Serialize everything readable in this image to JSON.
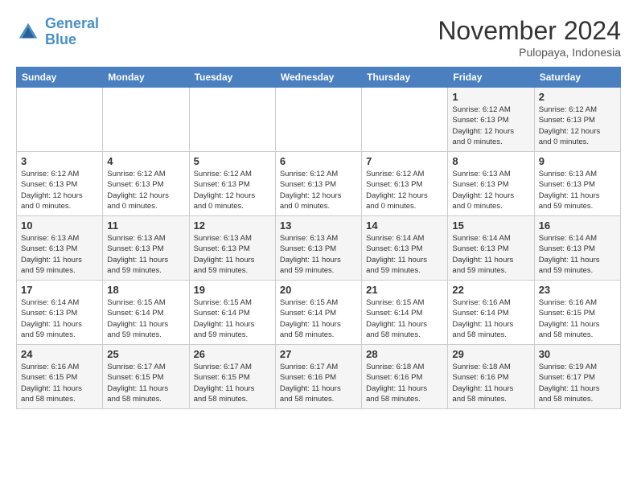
{
  "logo": {
    "line1": "General",
    "line2": "Blue"
  },
  "title": "November 2024",
  "subtitle": "Pulopaya, Indonesia",
  "days_of_week": [
    "Sunday",
    "Monday",
    "Tuesday",
    "Wednesday",
    "Thursday",
    "Friday",
    "Saturday"
  ],
  "weeks": [
    [
      {
        "day": "",
        "info": ""
      },
      {
        "day": "",
        "info": ""
      },
      {
        "day": "",
        "info": ""
      },
      {
        "day": "",
        "info": ""
      },
      {
        "day": "",
        "info": ""
      },
      {
        "day": "1",
        "info": "Sunrise: 6:12 AM\nSunset: 6:13 PM\nDaylight: 12 hours\nand 0 minutes."
      },
      {
        "day": "2",
        "info": "Sunrise: 6:12 AM\nSunset: 6:13 PM\nDaylight: 12 hours\nand 0 minutes."
      }
    ],
    [
      {
        "day": "3",
        "info": "Sunrise: 6:12 AM\nSunset: 6:13 PM\nDaylight: 12 hours\nand 0 minutes."
      },
      {
        "day": "4",
        "info": "Sunrise: 6:12 AM\nSunset: 6:13 PM\nDaylight: 12 hours\nand 0 minutes."
      },
      {
        "day": "5",
        "info": "Sunrise: 6:12 AM\nSunset: 6:13 PM\nDaylight: 12 hours\nand 0 minutes."
      },
      {
        "day": "6",
        "info": "Sunrise: 6:12 AM\nSunset: 6:13 PM\nDaylight: 12 hours\nand 0 minutes."
      },
      {
        "day": "7",
        "info": "Sunrise: 6:12 AM\nSunset: 6:13 PM\nDaylight: 12 hours\nand 0 minutes."
      },
      {
        "day": "8",
        "info": "Sunrise: 6:13 AM\nSunset: 6:13 PM\nDaylight: 12 hours\nand 0 minutes."
      },
      {
        "day": "9",
        "info": "Sunrise: 6:13 AM\nSunset: 6:13 PM\nDaylight: 11 hours\nand 59 minutes."
      }
    ],
    [
      {
        "day": "10",
        "info": "Sunrise: 6:13 AM\nSunset: 6:13 PM\nDaylight: 11 hours\nand 59 minutes."
      },
      {
        "day": "11",
        "info": "Sunrise: 6:13 AM\nSunset: 6:13 PM\nDaylight: 11 hours\nand 59 minutes."
      },
      {
        "day": "12",
        "info": "Sunrise: 6:13 AM\nSunset: 6:13 PM\nDaylight: 11 hours\nand 59 minutes."
      },
      {
        "day": "13",
        "info": "Sunrise: 6:13 AM\nSunset: 6:13 PM\nDaylight: 11 hours\nand 59 minutes."
      },
      {
        "day": "14",
        "info": "Sunrise: 6:14 AM\nSunset: 6:13 PM\nDaylight: 11 hours\nand 59 minutes."
      },
      {
        "day": "15",
        "info": "Sunrise: 6:14 AM\nSunset: 6:13 PM\nDaylight: 11 hours\nand 59 minutes."
      },
      {
        "day": "16",
        "info": "Sunrise: 6:14 AM\nSunset: 6:13 PM\nDaylight: 11 hours\nand 59 minutes."
      }
    ],
    [
      {
        "day": "17",
        "info": "Sunrise: 6:14 AM\nSunset: 6:13 PM\nDaylight: 11 hours\nand 59 minutes."
      },
      {
        "day": "18",
        "info": "Sunrise: 6:15 AM\nSunset: 6:14 PM\nDaylight: 11 hours\nand 59 minutes."
      },
      {
        "day": "19",
        "info": "Sunrise: 6:15 AM\nSunset: 6:14 PM\nDaylight: 11 hours\nand 59 minutes."
      },
      {
        "day": "20",
        "info": "Sunrise: 6:15 AM\nSunset: 6:14 PM\nDaylight: 11 hours\nand 58 minutes."
      },
      {
        "day": "21",
        "info": "Sunrise: 6:15 AM\nSunset: 6:14 PM\nDaylight: 11 hours\nand 58 minutes."
      },
      {
        "day": "22",
        "info": "Sunrise: 6:16 AM\nSunset: 6:14 PM\nDaylight: 11 hours\nand 58 minutes."
      },
      {
        "day": "23",
        "info": "Sunrise: 6:16 AM\nSunset: 6:15 PM\nDaylight: 11 hours\nand 58 minutes."
      }
    ],
    [
      {
        "day": "24",
        "info": "Sunrise: 6:16 AM\nSunset: 6:15 PM\nDaylight: 11 hours\nand 58 minutes."
      },
      {
        "day": "25",
        "info": "Sunrise: 6:17 AM\nSunset: 6:15 PM\nDaylight: 11 hours\nand 58 minutes."
      },
      {
        "day": "26",
        "info": "Sunrise: 6:17 AM\nSunset: 6:15 PM\nDaylight: 11 hours\nand 58 minutes."
      },
      {
        "day": "27",
        "info": "Sunrise: 6:17 AM\nSunset: 6:16 PM\nDaylight: 11 hours\nand 58 minutes."
      },
      {
        "day": "28",
        "info": "Sunrise: 6:18 AM\nSunset: 6:16 PM\nDaylight: 11 hours\nand 58 minutes."
      },
      {
        "day": "29",
        "info": "Sunrise: 6:18 AM\nSunset: 6:16 PM\nDaylight: 11 hours\nand 58 minutes."
      },
      {
        "day": "30",
        "info": "Sunrise: 6:19 AM\nSunset: 6:17 PM\nDaylight: 11 hours\nand 58 minutes."
      }
    ]
  ]
}
